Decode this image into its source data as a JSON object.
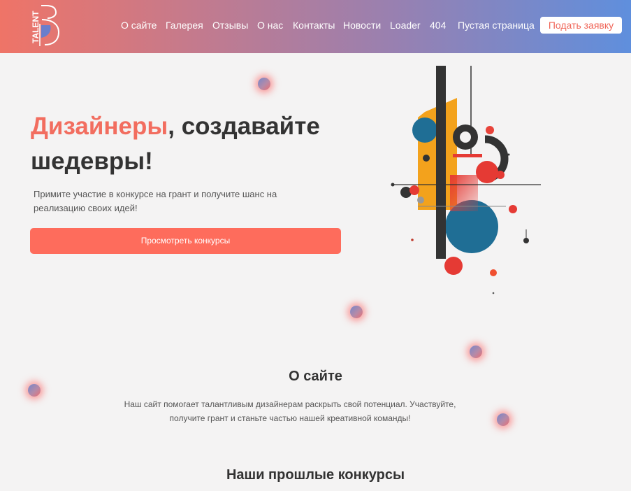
{
  "header": {
    "logo_text": "TALENT",
    "nav": [
      "О сайте",
      "Галерея",
      "Отзывы",
      "О нас",
      "Контакты",
      "Новости",
      "Loader",
      "404",
      "Пустая страница"
    ],
    "apply_button": "Подать заявку"
  },
  "hero": {
    "title_accent": "Дизайнеры",
    "title_rest": ", создавайте шедевры!",
    "subtitle": "Примите участие в конкурсе на грант и получите шанс на реализацию своих идей!",
    "cta": "Просмотреть конкурсы"
  },
  "about": {
    "title": "О сайте",
    "text": "Наш сайт помогает талантливым дизайнерам раскрыть свой потенциал. Участвуйте, получите грант и станьте частью нашей креативной команды!"
  },
  "past": {
    "title": "Наши прошлые конкурсы"
  },
  "colors": {
    "accent": "#fe6c5c",
    "header_gradient_start": "#ef7467",
    "header_gradient_end": "#5f8fdd"
  }
}
